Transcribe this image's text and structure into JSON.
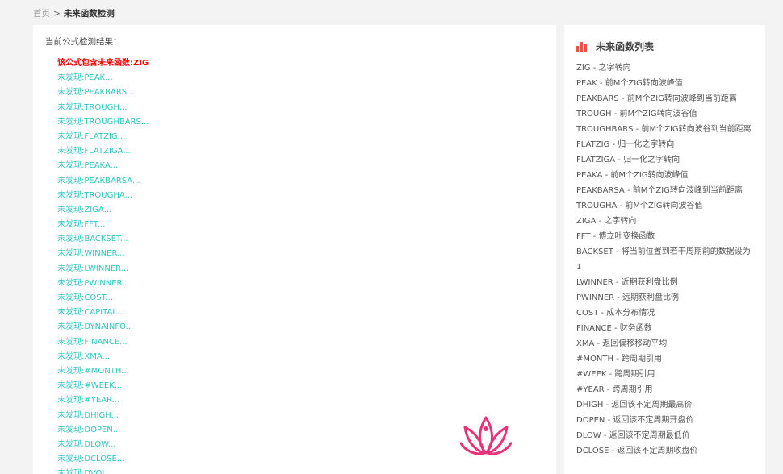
{
  "breadcrumb": {
    "home": "首页",
    "separator": ">",
    "current": "未来函数检测"
  },
  "main": {
    "heading": "当前公式检测结果：",
    "results": [
      {
        "text": "该公式包含未来函数:ZIG",
        "status": "found"
      },
      {
        "text": "未发现:PEAK...",
        "status": "not-found"
      },
      {
        "text": "未发现:PEAKBARS...",
        "status": "not-found"
      },
      {
        "text": "未发现:TROUGH...",
        "status": "not-found"
      },
      {
        "text": "未发现:TROUGHBARS...",
        "status": "not-found"
      },
      {
        "text": "未发现:FLATZIG...",
        "status": "not-found"
      },
      {
        "text": "未发现:FLATZIGA...",
        "status": "not-found"
      },
      {
        "text": "未发现:PEAKA...",
        "status": "not-found"
      },
      {
        "text": "未发现:PEAKBARSA...",
        "status": "not-found"
      },
      {
        "text": "未发现:TROUGHA...",
        "status": "not-found"
      },
      {
        "text": "未发现:ZIGA...",
        "status": "not-found"
      },
      {
        "text": "未发现:FFT...",
        "status": "not-found"
      },
      {
        "text": "未发现:BACKSET...",
        "status": "not-found"
      },
      {
        "text": "未发现:WINNER...",
        "status": "not-found"
      },
      {
        "text": "未发现:LWINNER...",
        "status": "not-found"
      },
      {
        "text": "未发现:PWINNER...",
        "status": "not-found"
      },
      {
        "text": "未发现:COST...",
        "status": "not-found"
      },
      {
        "text": "未发现:CAPITAL...",
        "status": "not-found"
      },
      {
        "text": "未发现:DYNAINFO...",
        "status": "not-found"
      },
      {
        "text": "未发现:FINANCE...",
        "status": "not-found"
      },
      {
        "text": "未发现:XMA...",
        "status": "not-found"
      },
      {
        "text": "未发现:#MONTH...",
        "status": "not-found"
      },
      {
        "text": "未发现:#WEEK...",
        "status": "not-found"
      },
      {
        "text": "未发现:#YEAR...",
        "status": "not-found"
      },
      {
        "text": "未发现:DHIGH...",
        "status": "not-found"
      },
      {
        "text": "未发现:DOPEN...",
        "status": "not-found"
      },
      {
        "text": "未发现:DLOW...",
        "status": "not-found"
      },
      {
        "text": "未发现:DCLOSE...",
        "status": "not-found"
      },
      {
        "text": "未发现:DVOL...",
        "status": "not-found"
      }
    ]
  },
  "sidebar": {
    "title": "未来函数列表",
    "icon": "bar-chart-icon",
    "items": [
      "ZIG - 之字转向",
      "PEAK - 前M个ZIG转向波峰值",
      "PEAKBARS - 前M个ZIG转向波峰到当前距离",
      "TROUGH - 前M个ZIG转向波谷值",
      "TROUGHBARS - 前M个ZIG转向波谷到当前距离",
      "FLATZIG - 归一化之字转向",
      "FLATZIGA - 归一化之字转向",
      "PEAKA - 前M个ZIG转向波峰值",
      "PEAKBARSA - 前M个ZIG转向波峰到当前距离",
      "TROUGHA - 前M个ZIG转向波谷值",
      "ZIGA - 之字转向",
      "FFT - 傅立叶变换函数",
      "BACKSET - 将当前位置到若干周期前的数据设为1",
      "LWINNER - 近期获利盘比例",
      "PWINNER - 远期获利盘比例",
      "COST - 成本分布情况",
      "FINANCE - 财务函数",
      "XMA - 返回偏移移动平均",
      "#MONTH - 跨周期引用",
      "#WEEK - 跨周期引用",
      "#YEAR - 跨周期引用",
      "DHIGH - 返回该不定周期最高价",
      "DOPEN - 返回该不定周期开盘价",
      "DLOW - 返回该不定周期最低价",
      "DCLOSE - 返回该不定周期收盘价"
    ]
  },
  "colors": {
    "found": "#ee0000",
    "not_found": "#2fc6c2",
    "accent_icon": "#e5524a",
    "watermark": "#e8337a"
  }
}
